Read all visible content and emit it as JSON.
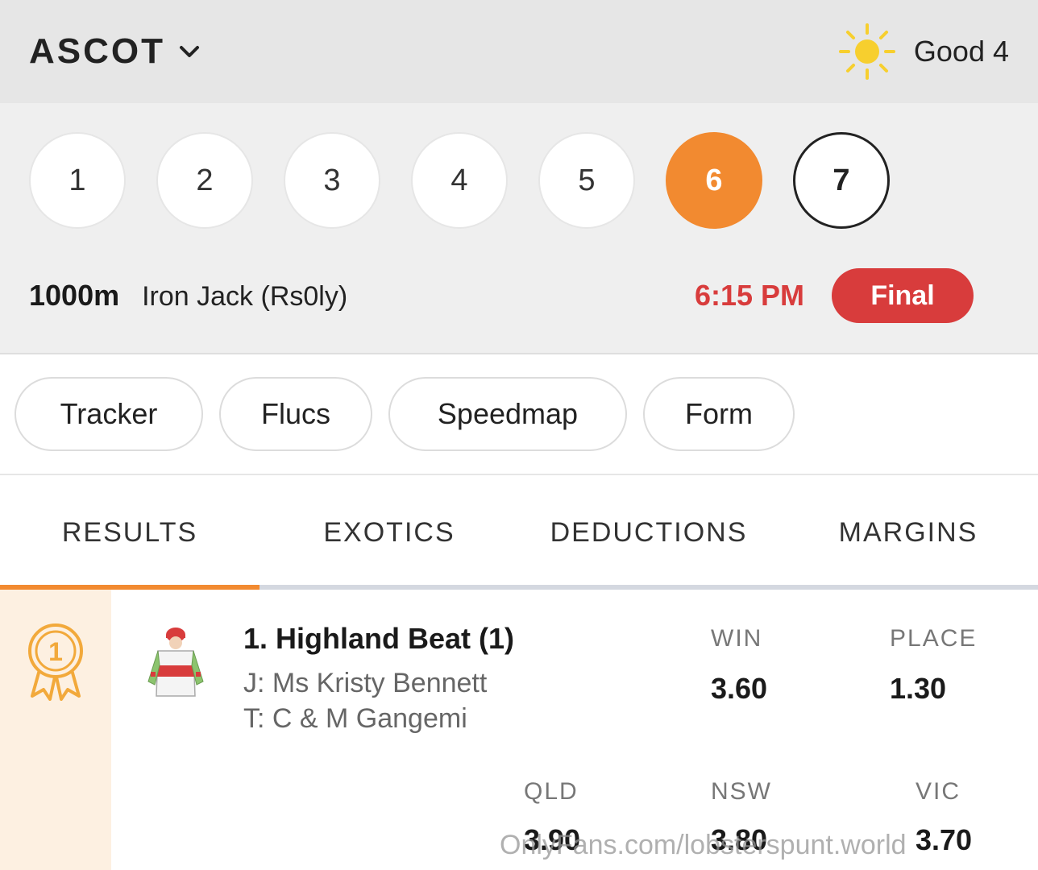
{
  "header": {
    "venue": "ASCOT",
    "track_condition": "Good 4",
    "weather_icon": "sun-icon",
    "chevron_icon": "chevron-down-icon"
  },
  "races": {
    "numbers": [
      "1",
      "2",
      "3",
      "4",
      "5",
      "6",
      "7"
    ],
    "active": "6",
    "outlined": "7",
    "active_color": "#f28a30"
  },
  "race_info": {
    "distance": "1000m",
    "name": "Iron Jack (Rs0ly)",
    "time": "6:15 PM",
    "status": "Final",
    "status_color": "#d83c3c"
  },
  "pills": [
    "Tracker",
    "Flucs",
    "Speedmap",
    "Form"
  ],
  "tabs": {
    "items": [
      "RESULTS",
      "EXOTICS",
      "DEDUCTIONS",
      "MARGINS"
    ],
    "active": "RESULTS"
  },
  "result": {
    "position_badge": "1",
    "runner": "1. Highland Beat (1)",
    "jockey": "J: Ms Kristy Bennett",
    "trainer": "T: C & M Gangemi",
    "win_label": "WIN",
    "win": "3.60",
    "place_label": "PLACE",
    "place": "1.30",
    "qld_label": "QLD",
    "qld": "3.90",
    "nsw_label": "NSW",
    "nsw": "3.80",
    "vic_label": "VIC",
    "vic": "3.70"
  },
  "watermark": "OnlyFans.com/lobsterspunt.world"
}
